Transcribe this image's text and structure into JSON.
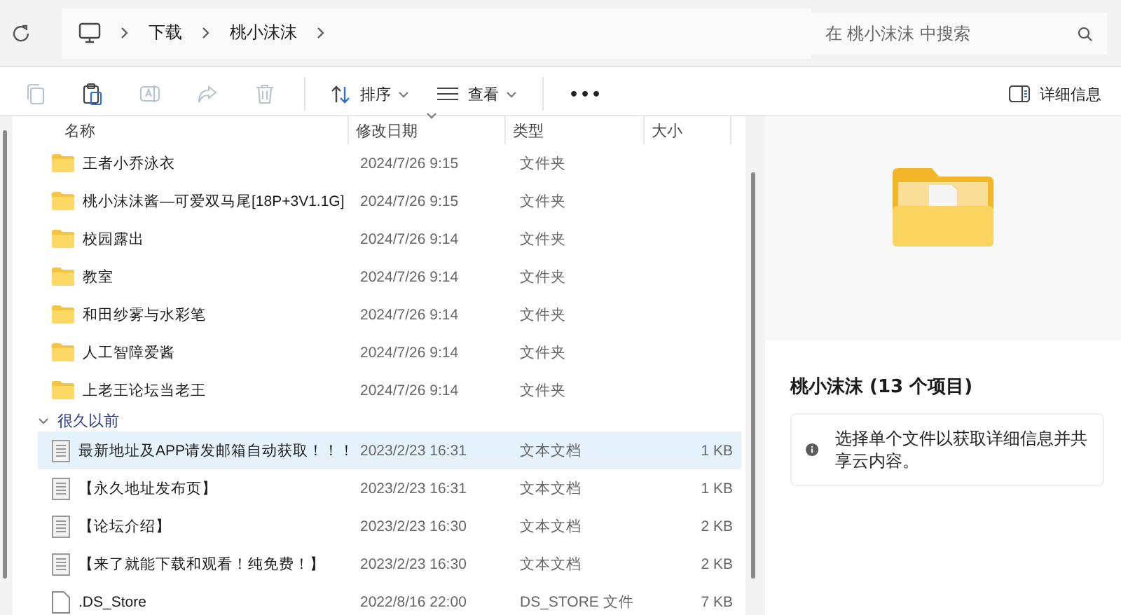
{
  "address_bar": {
    "breadcrumbs": [
      "下载",
      "桃小沫沫"
    ]
  },
  "search": {
    "placeholder": "在 桃小沫沫 中搜索"
  },
  "toolbar": {
    "actions": [
      {
        "kind": "copy",
        "disabled": true
      },
      {
        "kind": "paste",
        "disabled": false
      },
      {
        "kind": "rename",
        "disabled": true
      },
      {
        "kind": "share",
        "disabled": true
      },
      {
        "kind": "delete",
        "disabled": true
      }
    ],
    "sort": "排序",
    "view": "查看",
    "more": "•••",
    "details": "详细信息"
  },
  "table": {
    "columns": [
      "名称",
      "修改日期",
      "类型",
      "大小"
    ],
    "rows": [
      {
        "kind": "folder",
        "name": "王者小乔泳衣",
        "date": "2024/7/26 9:15",
        "type": "文件夹",
        "size": "",
        "selected": false
      },
      {
        "kind": "folder",
        "name": "桃小沫沫酱—可爱双马尾[18P+3V1.1G]",
        "date": "2024/7/26 9:15",
        "type": "文件夹",
        "size": "",
        "selected": false
      },
      {
        "kind": "folder",
        "name": "校园露出",
        "date": "2024/7/26 9:14",
        "type": "文件夹",
        "size": "",
        "selected": false
      },
      {
        "kind": "folder",
        "name": "教室",
        "date": "2024/7/26 9:14",
        "type": "文件夹",
        "size": "",
        "selected": false
      },
      {
        "kind": "folder",
        "name": "和田纱雾与水彩笔",
        "date": "2024/7/26 9:14",
        "type": "文件夹",
        "size": "",
        "selected": false
      },
      {
        "kind": "folder",
        "name": "人工智障爱酱",
        "date": "2024/7/26 9:14",
        "type": "文件夹",
        "size": "",
        "selected": false
      },
      {
        "kind": "folder",
        "name": "上老王论坛当老王",
        "date": "2024/7/26 9:14",
        "type": "文件夹",
        "size": "",
        "selected": false
      }
    ],
    "group": {
      "label": "很久以前",
      "expanded": true,
      "rows": [
        {
          "kind": "text",
          "name": "最新地址及APP请发邮箱自动获取！！！",
          "date": "2023/2/23 16:31",
          "type": "文本文档",
          "size": "1 KB",
          "selected": true
        },
        {
          "kind": "text",
          "name": "【永久地址发布页】",
          "date": "2023/2/23 16:31",
          "type": "文本文档",
          "size": "1 KB",
          "selected": false
        },
        {
          "kind": "text",
          "name": "【论坛介绍】",
          "date": "2023/2/23 16:30",
          "type": "文本文档",
          "size": "2 KB",
          "selected": false
        },
        {
          "kind": "text",
          "name": "【来了就能下载和观看！纯免费！】",
          "date": "2023/2/23 16:30",
          "type": "文本文档",
          "size": "2 KB",
          "selected": false
        },
        {
          "kind": "file",
          "name": ".DS_Store",
          "date": "2022/8/16 22:00",
          "type": "DS_STORE 文件",
          "size": "7 KB",
          "selected": false
        }
      ]
    }
  },
  "details_pane": {
    "title": "桃小沫沫 (13 个项目)",
    "info": "选择单个文件以获取详细信息并共享云内容。"
  }
}
